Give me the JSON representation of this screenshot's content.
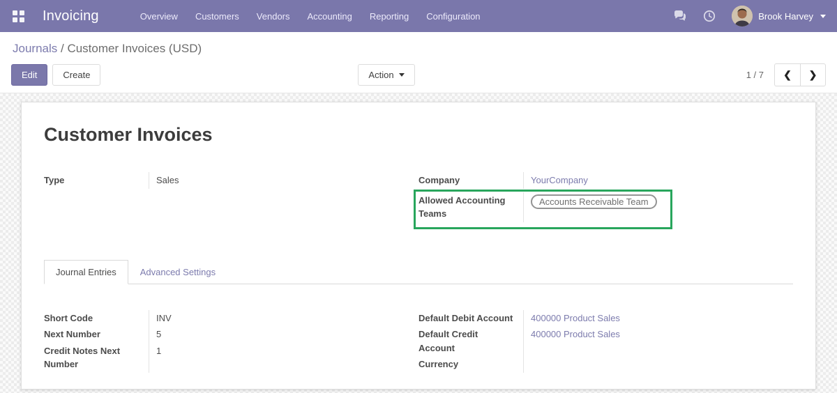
{
  "navbar": {
    "app_title": "Invoicing",
    "menu": [
      "Overview",
      "Customers",
      "Vendors",
      "Accounting",
      "Reporting",
      "Configuration"
    ],
    "user_name": "Brook Harvey",
    "icons": {
      "apps": "apps-grid-icon",
      "messages": "chat-bubbles-icon",
      "activities": "clock-icon",
      "user_caret": "caret-down"
    }
  },
  "control_panel": {
    "breadcrumb": {
      "parent": "Journals",
      "separator": " / ",
      "current": "Customer Invoices (USD)"
    },
    "edit_label": "Edit",
    "create_label": "Create",
    "action_label": "Action",
    "pager": {
      "current": "1 / 7",
      "prev_glyph": "❮",
      "next_glyph": "❯"
    }
  },
  "sheet": {
    "title": "Customer Invoices",
    "fields_top": {
      "left": [
        {
          "label": "Type",
          "value": "Sales"
        }
      ],
      "right": [
        {
          "label": "Company",
          "value": "YourCompany"
        },
        {
          "label": "Allowed Accounting Teams",
          "badge": "Accounts Receivable Team"
        }
      ]
    },
    "tabs": [
      {
        "label": "Journal Entries",
        "active": true
      },
      {
        "label": "Advanced Settings",
        "active": false
      }
    ],
    "fields_bottom": {
      "left": [
        {
          "label": "Short Code",
          "value": "INV"
        },
        {
          "label": "Next Number",
          "value": "5"
        },
        {
          "label": "Credit Notes Next Number",
          "value": "1"
        }
      ],
      "right": [
        {
          "label": "Default Debit Account",
          "value": "400000 Product Sales"
        },
        {
          "label": "Default Credit Account",
          "value": "400000 Product Sales"
        },
        {
          "label": "Currency",
          "value": ""
        }
      ]
    }
  },
  "colors": {
    "navbar_bg": "#7a77ab",
    "link_purple": "#7c7bad",
    "highlight_green": "#28a65c",
    "primary_button": "#7b78ab"
  }
}
